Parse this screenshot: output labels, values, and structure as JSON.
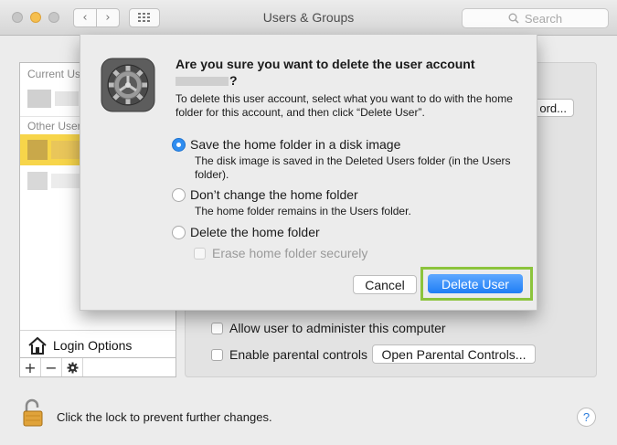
{
  "window": {
    "title": "Users & Groups"
  },
  "search": {
    "placeholder": "Search"
  },
  "user_list": {
    "current_users_label": "Current Us",
    "other_users_label": "Other User",
    "login_options_label": "Login Options",
    "add_label": "+",
    "remove_label": "−"
  },
  "right_panel": {
    "password_button_label": "ord...",
    "allow_admin_label": "Allow user to administer this computer",
    "parental_controls_label": "Enable parental controls",
    "open_parental_controls_label": "Open Parental Controls..."
  },
  "footer": {
    "lock_text": "Click the lock to prevent further changes.",
    "help_label": "?"
  },
  "dialog": {
    "title": "Are you sure you want to delete the user account",
    "title_end": "?",
    "description": "To delete this user account, select what you want to do with the home folder for this account, and then click “Delete User”.",
    "options": [
      {
        "label": "Save the home folder in a disk image",
        "detail": "The disk image is saved in the Deleted Users folder (in the Users folder).",
        "selected": true
      },
      {
        "label": "Don’t change the home folder",
        "detail": "The home folder remains in the Users folder.",
        "selected": false
      },
      {
        "label": "Delete the home folder",
        "detail": "",
        "selected": false
      }
    ],
    "erase_label": "Erase home folder securely",
    "cancel_label": "Cancel",
    "delete_label": "Delete User"
  },
  "colors": {
    "accent": "#2f8df0",
    "highlight": "#8cc43c",
    "selected_row": "#f7d54a"
  }
}
